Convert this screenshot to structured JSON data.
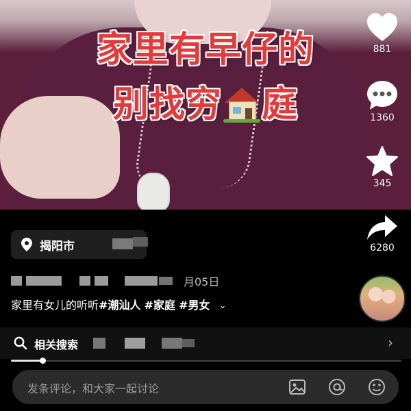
{
  "video": {
    "title_line1": "家里有早仔的",
    "title_line2_pre": "别找穷",
    "title_line2_post": "庭",
    "house_icon": "house-emoji-icon"
  },
  "rail": {
    "like_count": "881",
    "comment_count": "1360",
    "favorite_count": "345",
    "share_count": "6280"
  },
  "location": {
    "label": "揭阳市"
  },
  "post": {
    "date": "月05日",
    "caption_text": "家里有女儿的听听",
    "tags": [
      "#潮汕人",
      "#家庭",
      "#男女"
    ]
  },
  "related": {
    "label": "相关搜索"
  },
  "playback": {
    "progress": 0.08
  },
  "comment_bar": {
    "placeholder": "发条评论，和大家一起讨论",
    "icons": [
      "image-icon",
      "at-icon",
      "emoji-icon"
    ]
  },
  "colors": {
    "title_red": "#e13b3b",
    "background": "#000000",
    "shirt": "#5a1f3f"
  }
}
